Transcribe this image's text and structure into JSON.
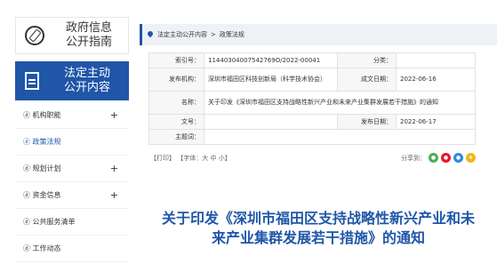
{
  "sidebar": {
    "guide_title_line1": "政府信息",
    "guide_title_line2": "公开指南",
    "public_title_line1": "法定主动",
    "public_title_line2": "公开内容",
    "items": [
      {
        "label": "ⓓ 机构职能",
        "expand": "+"
      },
      {
        "label": "ⓓ 政策法规",
        "expand": ""
      },
      {
        "label": "ⓓ 规划计划",
        "expand": "+"
      },
      {
        "label": "ⓓ 资金信息",
        "expand": "+"
      },
      {
        "label": "ⓓ 公共服务清单",
        "expand": ""
      },
      {
        "label": "ⓓ 工作动态",
        "expand": ""
      }
    ]
  },
  "breadcrumb": {
    "level1": "法定主动公开内容",
    "separator": ">",
    "level2": "政策法规"
  },
  "meta": {
    "index_label": "索引号：",
    "index_value": "11440304007542769O/2022-00041",
    "category_label": "分类：",
    "category_value": "",
    "publisher_label": "发布机构：",
    "publisher_value": "深圳市福田区科技创新局（科学技术协会）",
    "date_created_label": "成文日期：",
    "date_created_value": "2022-06-16",
    "name_label": "名称：",
    "name_prefix": "关于印发《深圳市福田区支持战略性新兴产业和未来产业集群发展若干措施》的",
    "name_suffix": "通知",
    "doc_no_label": "文号：",
    "doc_no_value": "",
    "publish_date_label": "发布日期：",
    "publish_date_value": "2022-06-17",
    "subject_label": "主题词：",
    "subject_value": ""
  },
  "toolbar": {
    "print": "【打印】",
    "font_label": "【字体：",
    "font_large": "大",
    "font_medium": "中",
    "font_small": "小",
    "font_close": "】",
    "share_label": "分享到："
  },
  "headline_line1": "关于印发《深圳市福田区支持战略性新兴产业和未",
  "headline_line2": "来产业集群发展若干措施》的通知",
  "colors": {
    "brand_blue": "#1f56a8",
    "link_red": "#c2292e"
  }
}
